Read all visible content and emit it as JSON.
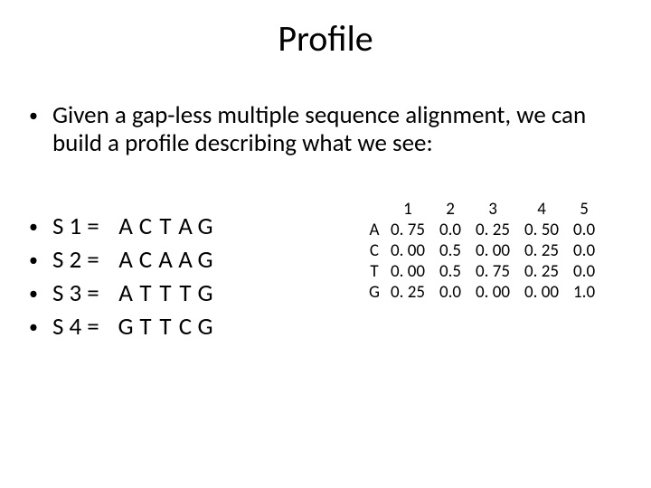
{
  "title": "Profile",
  "intro": "Given a gap-less multiple sequence alignment, we can build a profile describing what we see:",
  "sequences": [
    {
      "label": "S 1 =",
      "letters": [
        "A",
        "C",
        "T",
        "A",
        "G"
      ]
    },
    {
      "label": "S 2 =",
      "letters": [
        "A",
        "C",
        "A",
        "A",
        "G"
      ]
    },
    {
      "label": "S 3 =",
      "letters": [
        "A",
        "T",
        "T",
        "T",
        "G"
      ]
    },
    {
      "label": "S 4 =",
      "letters": [
        "G",
        "T",
        "T",
        "C",
        "G"
      ]
    }
  ],
  "profile_table": {
    "col_headers": [
      "1",
      "2",
      "3",
      "4",
      "5"
    ],
    "rows": [
      {
        "label": "A",
        "values": [
          "0. 75",
          "0.0",
          "0. 25",
          "0. 50",
          "0.0"
        ]
      },
      {
        "label": "C",
        "values": [
          "0. 00",
          "0.5",
          "0. 00",
          "0. 25",
          "0.0"
        ]
      },
      {
        "label": "T",
        "values": [
          "0. 00",
          "0.5",
          "0. 75",
          "0. 25",
          "0.0"
        ]
      },
      {
        "label": "G",
        "values": [
          "0. 25",
          "0.0",
          "0. 00",
          "0. 00",
          "1.0"
        ]
      }
    ]
  },
  "chart_data": {
    "type": "table",
    "title": "Profile",
    "columns": [
      1,
      2,
      3,
      4,
      5
    ],
    "rows": [
      "A",
      "C",
      "T",
      "G"
    ],
    "values": [
      [
        0.75,
        0.0,
        0.25,
        0.5,
        0.0
      ],
      [
        0.0,
        0.5,
        0.0,
        0.25,
        0.0
      ],
      [
        0.0,
        0.5,
        0.75,
        0.25,
        0.0
      ],
      [
        0.25,
        0.0,
        0.0,
        0.0,
        1.0
      ]
    ]
  }
}
